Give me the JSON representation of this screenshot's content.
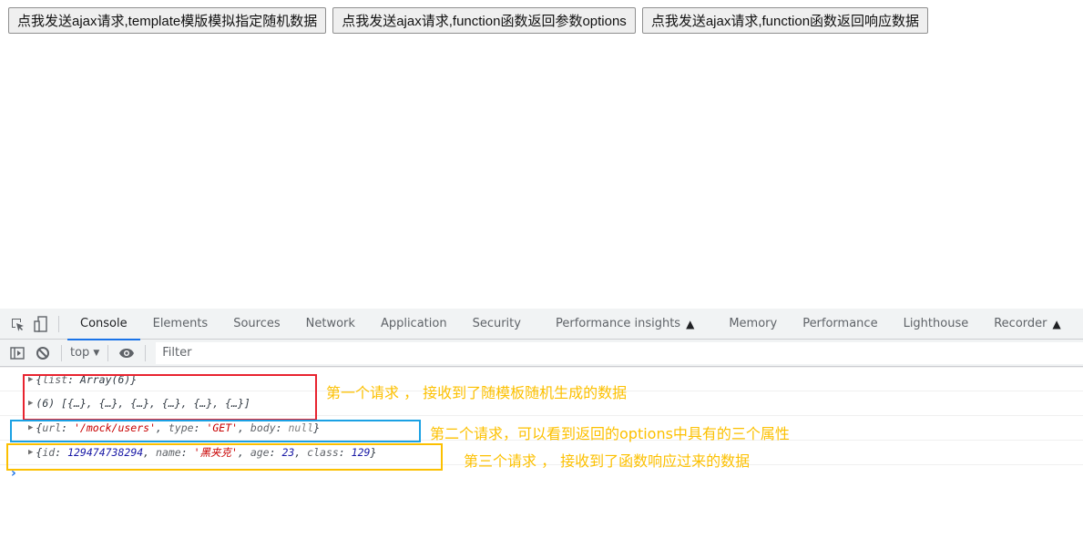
{
  "page": {
    "buttons": [
      {
        "label": "点我发送ajax请求,template模版模拟指定随机数据"
      },
      {
        "label": "点我发送ajax请求,function函数返回参数options"
      },
      {
        "label": "点我发送ajax请求,function函数返回响应数据"
      }
    ]
  },
  "devtools": {
    "tabs": [
      {
        "label": "Console",
        "active": true
      },
      {
        "label": "Elements"
      },
      {
        "label": "Sources"
      },
      {
        "label": "Network"
      },
      {
        "label": "Application"
      },
      {
        "label": "Security"
      },
      {
        "label": "Performance insights",
        "experimental": true
      },
      {
        "label": "Memory"
      },
      {
        "label": "Performance"
      },
      {
        "label": "Lighthouse"
      },
      {
        "label": "Recorder",
        "experimental": true
      }
    ],
    "toolbar": {
      "context": "top",
      "filter_placeholder": "Filter",
      "filter_value": ""
    },
    "console": {
      "rows": [
        {
          "parts": [
            [
              "p",
              "{"
            ],
            [
              "k",
              "list"
            ],
            [
              "p",
              ": Array(6)}"
            ]
          ]
        },
        {
          "parts": [
            [
              "p",
              "(6) [{…}, {…}, {…}, {…}, {…}, {…}]"
            ]
          ]
        },
        {
          "parts": [
            [
              "p",
              "{"
            ],
            [
              "k",
              "url"
            ],
            [
              "p",
              ": "
            ],
            [
              "s",
              "'/mock/users'"
            ],
            [
              "p",
              ", "
            ],
            [
              "k",
              "type"
            ],
            [
              "p",
              ": "
            ],
            [
              "s",
              "'GET'"
            ],
            [
              "p",
              ", "
            ],
            [
              "k",
              "body"
            ],
            [
              "p",
              ": "
            ],
            [
              "nl",
              "null"
            ],
            [
              "p",
              "}"
            ]
          ]
        },
        {
          "parts": [
            [
              "p",
              "{"
            ],
            [
              "k",
              "id"
            ],
            [
              "p",
              ": "
            ],
            [
              "n",
              "129474738294"
            ],
            [
              "p",
              ", "
            ],
            [
              "k",
              "name"
            ],
            [
              "p",
              ": "
            ],
            [
              "s",
              "'黑夹克'"
            ],
            [
              "p",
              ", "
            ],
            [
              "k",
              "age"
            ],
            [
              "p",
              ": "
            ],
            [
              "n",
              "23"
            ],
            [
              "p",
              ", "
            ],
            [
              "k",
              "class"
            ],
            [
              "p",
              ": "
            ],
            [
              "n",
              "129"
            ],
            [
              "p",
              "}"
            ]
          ]
        }
      ],
      "prompt": "›"
    },
    "annotations": [
      {
        "text": "第一个请求 ， 接收到了随模板随机生成的数据",
        "box_color": "#e8232f"
      },
      {
        "text": "第二个请求，可以看到返回的options中具有的三个属性",
        "box_color": "#1aa1e4"
      },
      {
        "text": "第三个请求 ， 接收到了函数响应过来的数据",
        "box_color": "#fcc000"
      }
    ],
    "annotation_text_color": "#fcc000"
  }
}
